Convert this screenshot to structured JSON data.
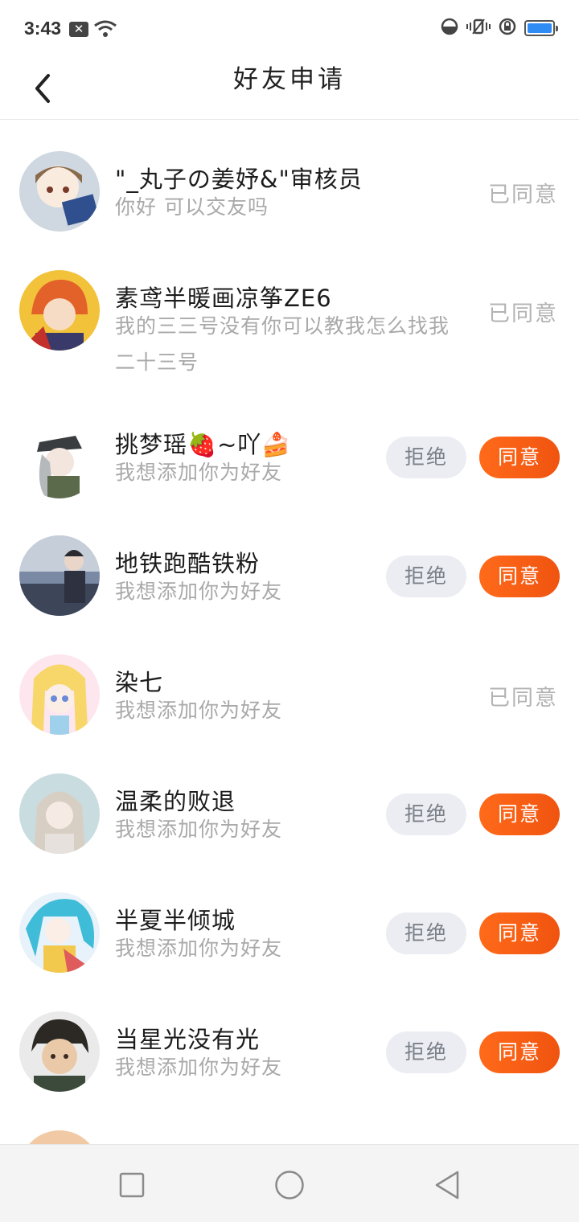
{
  "status_bar": {
    "time": "3:43"
  },
  "header": {
    "title": "好友申请"
  },
  "buttons": {
    "reject": "拒绝",
    "accept": "同意",
    "agreed": "已同意"
  },
  "requests": [
    {
      "nickname": "\"_丸子の姜妤&\"审核员",
      "message": "你好 可以交友吗",
      "status": "agreed"
    },
    {
      "nickname": "素鸢半暖画凉筝ZE6",
      "message": "我的三三号没有你可以教我怎么找我二十三号",
      "status": "agreed"
    },
    {
      "nickname": "挑梦瑶🍓~吖🍰",
      "message": "我想添加你为好友",
      "status": "pending"
    },
    {
      "nickname": "地铁跑酷铁粉",
      "message": "我想添加你为好友",
      "status": "pending"
    },
    {
      "nickname": "染七",
      "message": "我想添加你为好友",
      "status": "agreed"
    },
    {
      "nickname": "温柔的败退",
      "message": "我想添加你为好友",
      "status": "pending"
    },
    {
      "nickname": "半夏半倾城",
      "message": "我想添加你为好友",
      "status": "pending"
    },
    {
      "nickname": "当星光没有光",
      "message": "我想添加你为好友",
      "status": "pending"
    }
  ],
  "colors": {
    "accent": "#f05f14",
    "reject_bg": "#ebedf2",
    "battery": "#2f8cf5"
  }
}
